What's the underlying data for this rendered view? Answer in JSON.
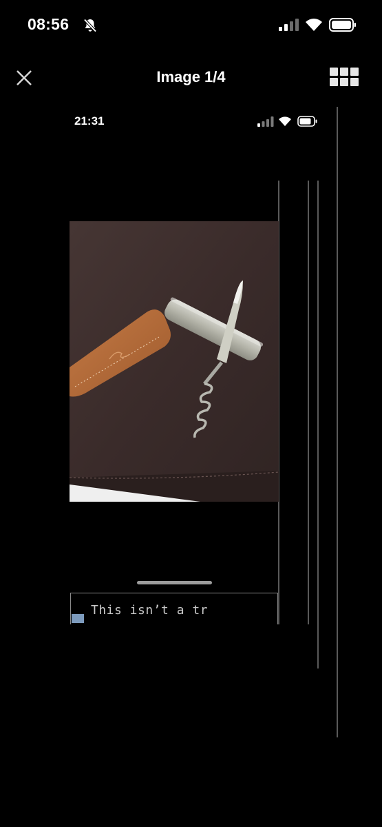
{
  "status_bar": {
    "time": "08:56",
    "icons": [
      "bell-slash-icon",
      "cellular-signal-icon",
      "wifi-icon",
      "battery-icon"
    ]
  },
  "viewer": {
    "title": "Image 1/4",
    "close_icon": "close-icon",
    "grid_icon": "grid-icon"
  },
  "screenshot": {
    "status_time": "21:31",
    "icons": [
      "cellular-signal-icon",
      "wifi-icon",
      "battery-icon"
    ],
    "photo_description_icon": "corkscrew-photo",
    "text_field_value": "This isn’t a tr",
    "colors": {
      "leather_background": "#3b2c2b",
      "case_leather": "#b46a3a",
      "cursor": "#7d9bbd"
    }
  }
}
